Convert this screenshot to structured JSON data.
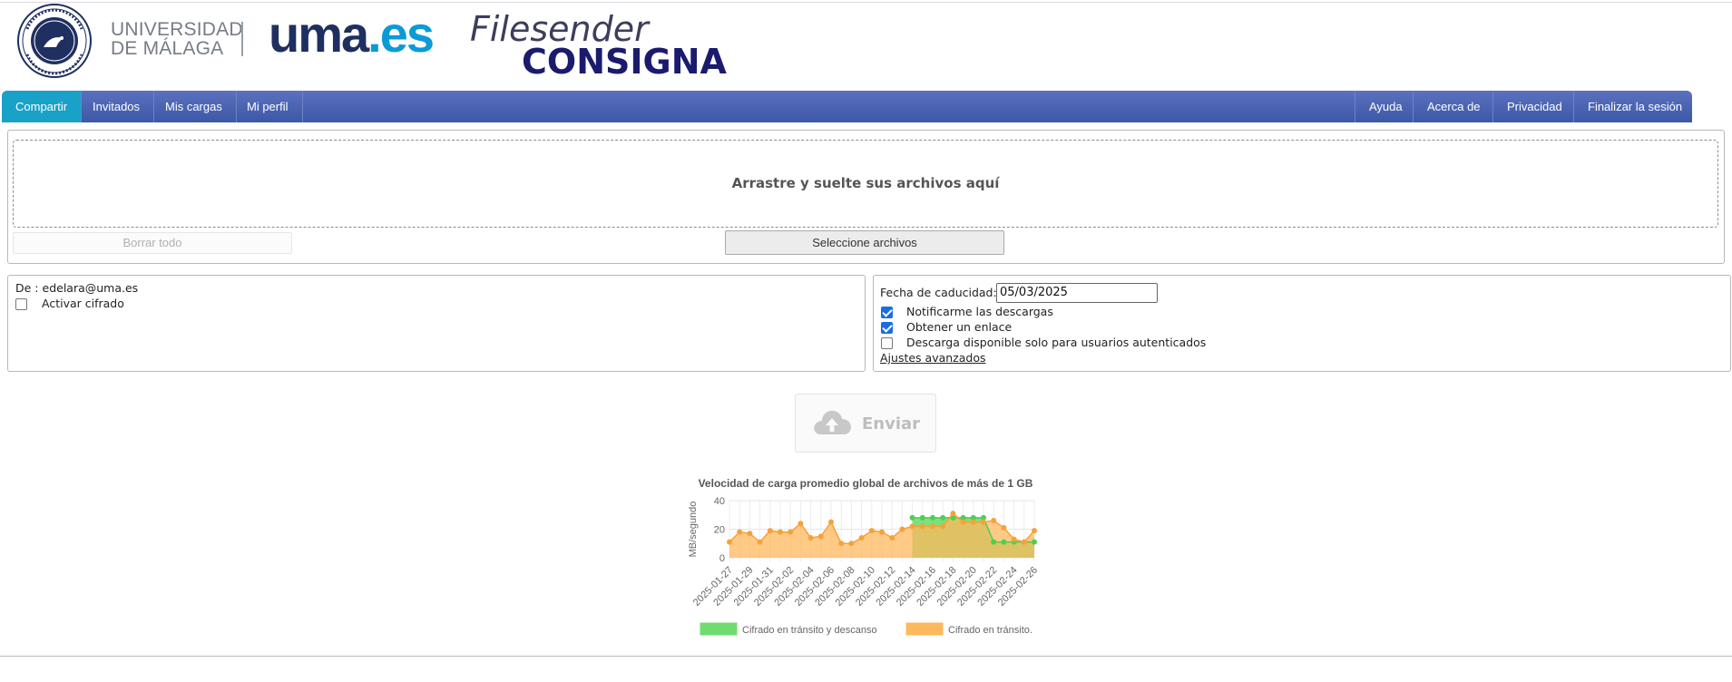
{
  "header": {
    "university_line1": "UNIVERSIDAD",
    "university_line2": "DE MÁLAGA",
    "logo_part1": "uma",
    "logo_part2": ".es",
    "app_title": "Filesender",
    "app_subtitle": "CONSIGNA",
    "colors": {
      "uma_dark": "#1f2f60",
      "uma_cyan": "#0a9bd7",
      "title": "#3d3d5c",
      "subtitle": "#1b1b6e"
    }
  },
  "nav": {
    "left": [
      {
        "label": "Compartir",
        "active": true
      },
      {
        "label": "Invitados",
        "active": false
      },
      {
        "label": "Mis cargas",
        "active": false
      },
      {
        "label": "Mi perfil",
        "active": false
      }
    ],
    "right": [
      {
        "label": "Ayuda"
      },
      {
        "label": "Acerca de"
      },
      {
        "label": "Privacidad"
      },
      {
        "label": "Finalizar la sesión"
      }
    ],
    "colors": {
      "bar": "#4763b2",
      "active": "#1aa1c8"
    }
  },
  "upload": {
    "drop_text": "Arrastre y suelte sus archivos aquí",
    "clear_button": "Borrar todo",
    "select_button": "Seleccione archivos"
  },
  "left_options": {
    "from_label": "De :",
    "from_value": "edelara@uma.es",
    "encrypt_label": "Activar cifrado",
    "encrypt_checked": false
  },
  "right_options": {
    "expiry_label": "Fecha de caducidad:",
    "expiry_value": "05/03/2025",
    "notify_label": "Notificarme las descargas",
    "notify_checked": true,
    "link_label": "Obtener un enlace",
    "link_checked": true,
    "auth_only_label": "Descarga disponible solo para usuarios autenticados",
    "auth_only_checked": false,
    "advanced_label": "Ajustes avanzados"
  },
  "send_button": {
    "label": "Enviar",
    "icon": "cloud-upload-icon"
  },
  "chart_data": {
    "type": "area",
    "title": "Velocidad de carga promedio global de archivos de más de 1 GB",
    "xlabel": "",
    "ylabel": "MB/segundo",
    "ylim": [
      0,
      40
    ],
    "yticks": [
      0,
      20,
      40
    ],
    "grid": true,
    "legend_position": "bottom",
    "x": [
      "2025-01-27",
      "2025-01-28",
      "2025-01-29",
      "2025-01-30",
      "2025-01-31",
      "2025-02-01",
      "2025-02-02",
      "2025-02-03",
      "2025-02-04",
      "2025-02-05",
      "2025-02-06",
      "2025-02-07",
      "2025-02-08",
      "2025-02-09",
      "2025-02-10",
      "2025-02-11",
      "2025-02-12",
      "2025-02-13",
      "2025-02-14",
      "2025-02-15",
      "2025-02-16",
      "2025-02-17",
      "2025-02-18",
      "2025-02-19",
      "2025-02-20",
      "2025-02-21",
      "2025-02-22",
      "2025-02-23",
      "2025-02-24",
      "2025-02-25",
      "2025-02-26"
    ],
    "x_tick_labels": [
      "2025-01-27",
      "2025-01-29",
      "2025-01-31",
      "2025-02-02",
      "2025-02-04",
      "2025-02-06",
      "2025-02-08",
      "2025-02-10",
      "2025-02-12",
      "2025-02-14",
      "2025-02-16",
      "2025-02-18",
      "2025-02-20",
      "2025-02-22",
      "2025-02-24",
      "2025-02-26"
    ],
    "series": [
      {
        "name": "Cifrado en tránsito y descanso",
        "color": "#6fdc6f",
        "values": [
          null,
          null,
          null,
          null,
          null,
          null,
          null,
          null,
          null,
          null,
          null,
          null,
          null,
          null,
          null,
          null,
          null,
          null,
          28,
          28,
          28,
          28,
          28,
          28,
          28,
          28,
          11,
          11,
          11,
          11,
          11
        ]
      },
      {
        "name": "Cifrado en tránsito.",
        "color": "#ffb85c",
        "values": [
          11,
          18,
          17,
          11,
          19,
          18,
          18,
          24,
          14,
          15,
          25,
          10,
          10,
          14,
          19,
          18,
          14,
          20,
          22,
          22,
          22,
          22,
          31,
          25,
          25,
          25,
          26,
          21,
          13,
          11,
          19
        ]
      }
    ]
  }
}
